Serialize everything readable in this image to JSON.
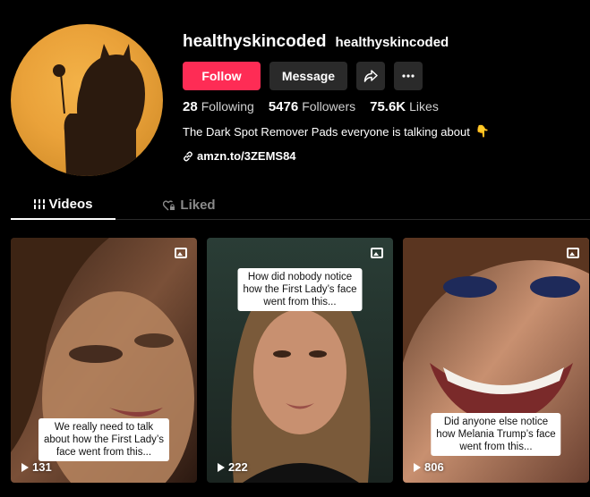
{
  "profile": {
    "username": "healthyskincoded",
    "nickname": "healthyskincoded",
    "bio": "The Dark Spot Remover Pads everyone is talking about",
    "bio_emoji": "👇",
    "link": "amzn.to/3ZEMS84"
  },
  "buttons": {
    "follow": "Follow",
    "message": "Message",
    "share_icon": "share-icon",
    "more_icon": "more-icon"
  },
  "stats": [
    {
      "value": "28",
      "label": "Following"
    },
    {
      "value": "5476",
      "label": "Followers"
    },
    {
      "value": "75.6K",
      "label": "Likes"
    }
  ],
  "tabs": [
    {
      "label": "Videos",
      "icon": "grid-icon",
      "active": true
    },
    {
      "label": "Liked",
      "icon": "heart-lock-icon",
      "active": false
    }
  ],
  "videos": [
    {
      "caption_lines": [
        "We really need to talk",
        "about how the First Lady’s",
        "face went from this..."
      ],
      "views": "131",
      "caption_pos": "bottom"
    },
    {
      "caption_lines": [
        "How did nobody notice",
        "how the First Lady’s face",
        "went from this..."
      ],
      "views": "222",
      "caption_pos": "top"
    },
    {
      "caption_lines": [
        "Did anyone else notice",
        "how Melania Trump’s face",
        "went from this..."
      ],
      "views": "806",
      "caption_pos": "bottom"
    }
  ],
  "colors": {
    "accent": "#fe2c55",
    "background": "#000000",
    "button_secondary": "#2a2a2a"
  }
}
